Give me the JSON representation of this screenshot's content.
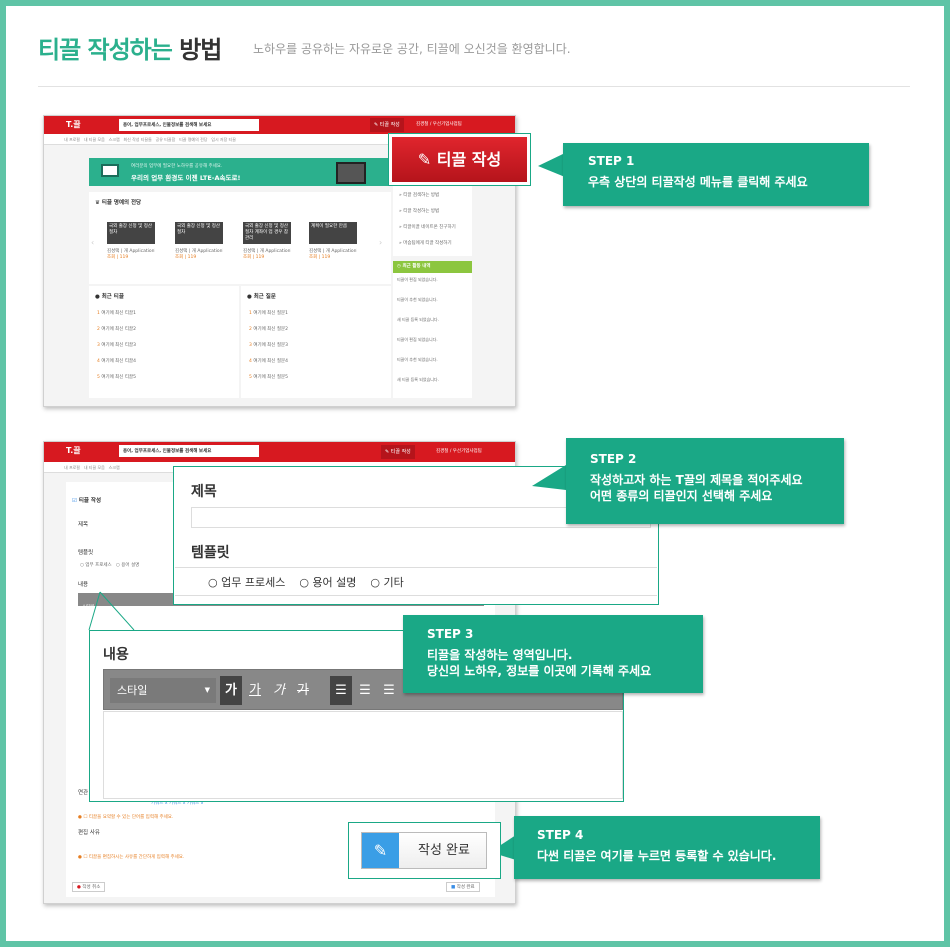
{
  "header": {
    "title_green": "티끌 작성하는",
    "title_dark": "방법",
    "subtitle": "노하우를 공유하는 자유로운 공간, 티끌에 오신것을 환영합니다."
  },
  "app": {
    "logo": "T.끌",
    "search_value": "용어, 업무프로세스, 인물정보를 검색해 보세요",
    "write_button": "티끌 작성",
    "user_text": "김경철 / 우선기업사업팀",
    "subnav": [
      "내 프로필",
      "내 티끌 모음",
      "스크랩",
      "최신 작성 티끌들",
      "공유 티끌함",
      "티끌 명예의 전당",
      "임시 저장 티끌"
    ]
  },
  "shot1": {
    "banner_line1": "여러분의 업무에 필요한 노하우를 공유해 주세요.",
    "banner_line2": "우리의 업무 환경도 이젠 LTE-A속도로!",
    "hall_title": "티끌 명예의 전당",
    "cards": [
      {
        "title": "국외 출장 신청 및 정산 절차",
        "author": "김성택 | 개 Application팀",
        "meta": "조회 | 119"
      },
      {
        "title": "국외 출장 신청 및 정산 절차",
        "author": "김성택 | 개 Application팀",
        "meta": "조회 | 119"
      },
      {
        "title": "국외 출장 신청 및 정산 절차 계좌이 업 경우 참 관리",
        "author": "김성택 | 개 Application팀",
        "meta": "조회 | 119"
      },
      {
        "title": "계획이 필요한 만큼",
        "author": "김성택 | 개 Application팀",
        "meta": "조회 | 119"
      }
    ],
    "recent_tikkle_title": "최근 티끌",
    "recent_tikkle": [
      "여기에 최신 티끌1",
      "여기에 최신 티끌2",
      "여기에 최신 티끌3",
      "여기에 최신 티끌4",
      "여기에 최신 티끌5"
    ],
    "recent_question_title": "최근 질문",
    "recent_question": [
      "여기에 최신 질문1",
      "여기에 최신 질문2",
      "여기에 최신 질문3",
      "여기에 최신 질문4",
      "여기에 최신 질문5"
    ],
    "right_links": [
      "티끌 검색하는 방법",
      "티끌 작성하는 방법",
      "티끌이끌 네이트온 친구하기",
      "머슴팀에게 티끌 작성하기"
    ],
    "activity_title": "최근 활동 내역",
    "activity": [
      "티끌이 편집 되었습니다.",
      "티끌이 추천 되었습니다.",
      "새 티끌 등록 되었습니다.",
      "티끌이 편집 되었습니다.",
      "티끌이 추천 되었습니다.",
      "새 티끌 등록 되었습니다."
    ]
  },
  "zoom1": {
    "write_button": "티끌 작성"
  },
  "shot2": {
    "form_title": "티끌 작성",
    "label_title": "제목",
    "label_template": "템플릿",
    "radio": [
      "업무 프로세스",
      "용어 설명"
    ],
    "label_content": "내용",
    "toolbar_style": "스타일",
    "label_related": "연관",
    "tags": [
      "키워드 x",
      "키워드 x",
      "키워드 x"
    ],
    "warn1": "티끌을 요약할 수 있는 단어를 입력해 주세요.",
    "label_edit_reason": "편집 사유",
    "warn2": "티끌을 편집하시는 사유를 간단하게 입력해 주세요.",
    "cancel_button": "작성 취소",
    "done_button": "작성 완료"
  },
  "zoom2": {
    "label_title": "제목",
    "label_template": "템플릿",
    "radio": [
      "업무 프로세스",
      "용어 설명",
      "기타"
    ]
  },
  "zoom3": {
    "label_content": "내용",
    "toolbar_style": "스타일",
    "toolbar_buttons": [
      "가",
      "가",
      "가",
      "가"
    ]
  },
  "zoom4": {
    "done_button": "작성 완료"
  },
  "steps": [
    {
      "label": "STEP 1",
      "desc": "우측 상단의 티끌작성 메뉴를 클릭해 주세요"
    },
    {
      "label": "STEP 2",
      "desc1": "작성하고자 하는 T끌의 제목을 적어주세요",
      "desc2": "어떤 종류의 티끌인지 선택해 주세요"
    },
    {
      "label": "STEP 3",
      "desc1": "티끌을 작성하는 영역입니다.",
      "desc2": "당신의 노하우, 정보를 이곳에 기록해 주세요"
    },
    {
      "label": "STEP 4",
      "desc": "다썬 티끌은 여기를 누르면 등록할 수 있습니다."
    }
  ],
  "colors": {
    "accent": "#1aa886",
    "frame": "#5fc4a6",
    "brand_red": "#d71920"
  },
  "icons": [
    "pencil-icon",
    "radio-icon",
    "warning-icon",
    "caret-icon",
    "question-icon",
    "clock-icon"
  ]
}
